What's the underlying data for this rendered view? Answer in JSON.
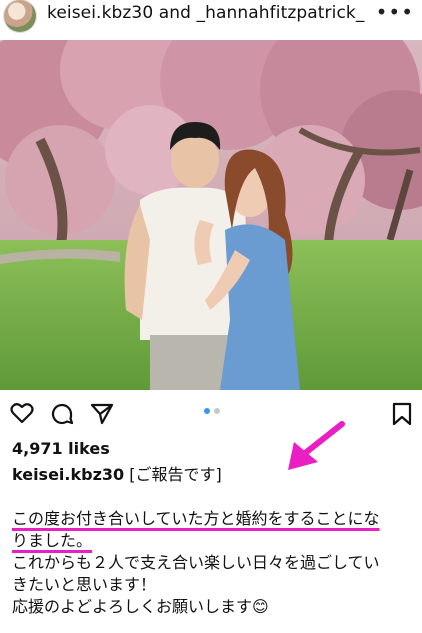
{
  "header": {
    "title": "keisei.kbz30 and _hannahfitzpatrick_",
    "more_icon": "ellipsis-icon"
  },
  "post": {
    "likes": "4,971 likes",
    "caption_user": "keisei.kbz30",
    "caption_head": "[ご報告です]",
    "caption_lines": [
      "この度お付き合いしていた方と婚約をすることにな",
      "りました。",
      "これからも２人で支え合い楽しい日々を過ごしてい",
      "きたいと思います！",
      "応援のよどよろしくお願いします😊"
    ]
  },
  "icons": [
    "heart-icon",
    "comment-icon",
    "share-icon",
    "bookmark-icon"
  ],
  "colors": {
    "highlight": "#e91ec3",
    "carousel_active": "#3897f0"
  }
}
